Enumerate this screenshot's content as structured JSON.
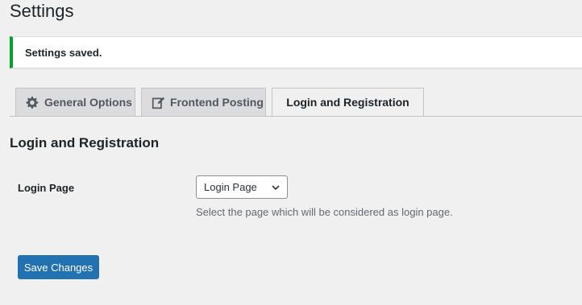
{
  "page": {
    "title": "Settings"
  },
  "notice": {
    "text": "Settings saved.",
    "color": "#00a32a"
  },
  "tabs": [
    {
      "label": "General Options",
      "icon": "gear-icon",
      "active": false
    },
    {
      "label": "Frontend Posting",
      "icon": "edit-icon",
      "active": false
    },
    {
      "label": "Login and Registration",
      "icon": "",
      "active": true
    }
  ],
  "section": {
    "title": "Login and Registration"
  },
  "login_page_field": {
    "label": "Login Page",
    "selected": "Login Page",
    "description": "Select the page which will be considered as login page."
  },
  "save_button": {
    "label": "Save Changes",
    "color": "#2271b1"
  }
}
